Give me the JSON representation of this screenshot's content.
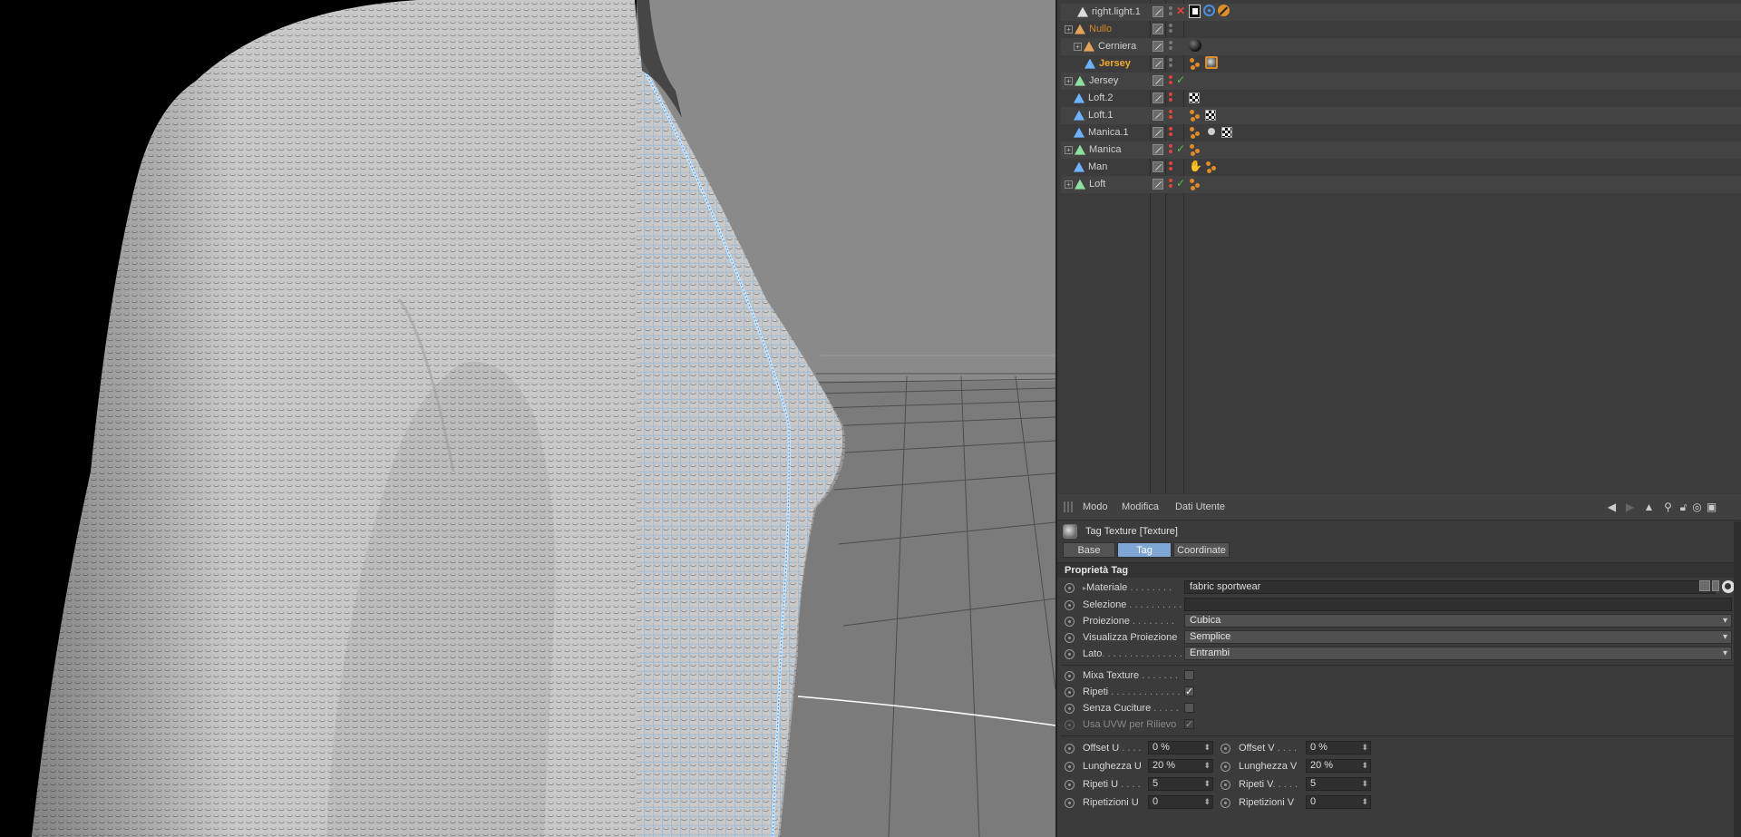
{
  "objects": [
    {
      "name": "right.light.1",
      "style": "normal",
      "check": "x",
      "tags": [
        "light",
        "target",
        "block"
      ]
    },
    {
      "name": "Nullo",
      "style": "orange",
      "check": "",
      "tags": []
    },
    {
      "name": "Cerniera",
      "style": "normal",
      "check": "",
      "tags": [
        "sphere"
      ]
    },
    {
      "name": "Jersey",
      "style": "active",
      "check": "",
      "tags": [
        "dots",
        "sphere-sel"
      ]
    },
    {
      "name": "Jersey",
      "style": "normal",
      "check": "v",
      "tags": []
    },
    {
      "name": "Loft.2",
      "style": "normal",
      "check": "",
      "tags": [
        "checker"
      ]
    },
    {
      "name": "Loft.1",
      "style": "normal",
      "check": "",
      "tags": [
        "dots",
        "checker"
      ]
    },
    {
      "name": "Manica.1",
      "style": "normal",
      "check": "",
      "tags": [
        "dots",
        "weight",
        "checker"
      ]
    },
    {
      "name": "Manica",
      "style": "normal",
      "check": "v",
      "tags": [
        "dots"
      ]
    },
    {
      "name": "Man",
      "style": "normal",
      "check": "",
      "tags": [
        "hand",
        "dots"
      ]
    },
    {
      "name": "Loft",
      "style": "normal",
      "check": "v",
      "tags": [
        "dots"
      ]
    }
  ],
  "attributes": {
    "menu": [
      "Modo",
      "Modifica",
      "Dati Utente"
    ],
    "header_title": "Tag Texture [Texture]",
    "tabs": [
      "Base",
      "Tag",
      "Coordinate"
    ],
    "active_tab": "Tag",
    "section": "Proprietà Tag",
    "material_label": "Materiale",
    "material_dots": " . . . . . . . .",
    "material_value": "fabric sportwear",
    "selezione_label": "Selezione",
    "selezione_dots": " . . . . . . . . . .",
    "selezione_value": "",
    "proiezione_label": "Proiezione",
    "proiezione_dots": " . . . . . . . .",
    "proiezione_value": "Cubica",
    "vis_proiezione_label": "Visualizza Proiezione",
    "vis_proiezione_value": "Semplice",
    "lato_label": "Lato",
    "lato_dots": ". . . . . . . . . . . . . . .",
    "lato_value": "Entrambi",
    "mixa_label": "Mixa Texture",
    "mixa_dots": " . . . . . . .",
    "mixa_checked": "",
    "ripeti_label": "Ripeti",
    "ripeti_dots": " . . . . . . . . . . . . .",
    "ripeti_checked": "✓",
    "senza_label": "Senza Cuciture",
    "senza_dots": " . . . . .",
    "senza_checked": "",
    "uvw_label": "Usa UVW per Rilievo",
    "uvw_checked": "✓",
    "offset_u_label": "Offset U",
    "offset_u_dots": " . . . .",
    "offset_u_value": "0 %",
    "offset_v_label": "Offset V",
    "offset_v_dots": " . . . .",
    "offset_v_value": "0 %",
    "lung_u_label": "Lunghezza U",
    "lung_u_value": "20 %",
    "lung_v_label": "Lunghezza V",
    "lung_v_value": "20 %",
    "rip_u_label": "Ripeti U",
    "rip_u_dots": " . . . .",
    "rip_u_value": "5",
    "rip_v_label": "Ripeti V",
    "rip_v_dots": ". . . . .",
    "rip_v_value": "5",
    "ripz_u_label": "Ripetizioni U",
    "ripz_u_value": "0",
    "ripz_v_label": "Ripetizioni V",
    "ripz_v_value": "0"
  },
  "colors": {
    "active_object": "#f0a930",
    "tab_active": "#7fa7d6",
    "selection_wire": "#5da8e8",
    "enabled_check": "#58c24a",
    "disabled_x": "#e0443a"
  }
}
